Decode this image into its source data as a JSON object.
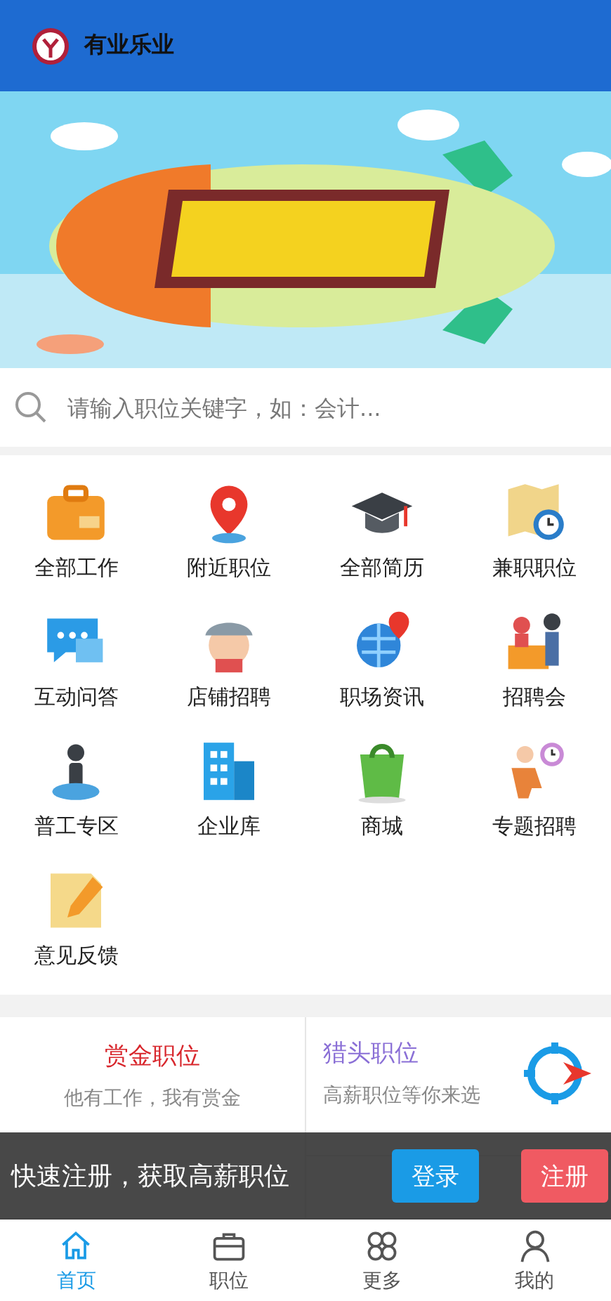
{
  "header": {
    "title": "有业乐业"
  },
  "search": {
    "placeholder": "请输入职位关键字，如：会计..."
  },
  "menu": [
    {
      "label": "全部工作"
    },
    {
      "label": "附近职位"
    },
    {
      "label": "全部简历"
    },
    {
      "label": "兼职职位"
    },
    {
      "label": "互动问答"
    },
    {
      "label": "店铺招聘"
    },
    {
      "label": "职场资讯"
    },
    {
      "label": "招聘会"
    },
    {
      "label": "普工专区"
    },
    {
      "label": "企业库"
    },
    {
      "label": "商城"
    },
    {
      "label": "专题招聘"
    },
    {
      "label": "意见反馈"
    }
  ],
  "cards": [
    {
      "title": "赏金职位",
      "subtitle": "他有工作，我有赏金",
      "color": "#d8262c"
    },
    {
      "title": "猎头职位",
      "subtitle": "高薪职位等你来选",
      "color": "#8a6fd6"
    }
  ],
  "promo": {
    "text": "快速注册，获取高薪职位",
    "buttons": [
      "登录",
      "注册"
    ]
  },
  "tabbar": [
    {
      "label": "首页",
      "selected": true
    },
    {
      "label": "职位",
      "selected": false
    },
    {
      "label": "更多",
      "selected": false
    },
    {
      "label": "我的",
      "selected": false
    }
  ]
}
